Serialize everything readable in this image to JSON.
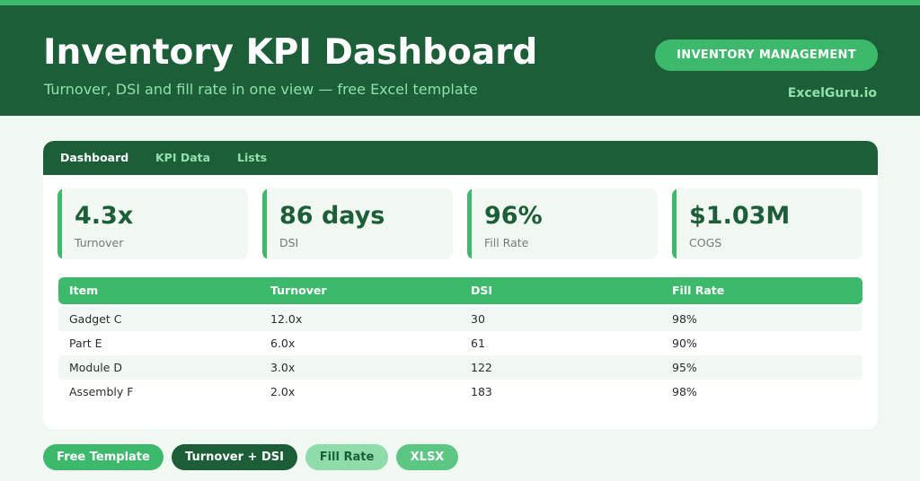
{
  "header": {
    "title": "Inventory KPI Dashboard",
    "subtitle": "Turnover, DSI and fill rate in one view — free Excel template",
    "badge": "INVENTORY MANAGEMENT",
    "brand": "ExcelGuru.io"
  },
  "tabs": [
    {
      "label": "Dashboard",
      "active": true
    },
    {
      "label": "KPI Data",
      "active": false
    },
    {
      "label": "Lists",
      "active": false
    }
  ],
  "kpis": [
    {
      "value": "4.3x",
      "label": "Turnover"
    },
    {
      "value": "86 days",
      "label": "DSI"
    },
    {
      "value": "96%",
      "label": "Fill Rate"
    },
    {
      "value": "$1.03M",
      "label": "COGS"
    }
  ],
  "table": {
    "columns": [
      "Item",
      "Turnover",
      "DSI",
      "Fill Rate"
    ],
    "rows": [
      [
        "Gadget C",
        "12.0x",
        "30",
        "98%"
      ],
      [
        "Part E",
        "6.0x",
        "61",
        "90%"
      ],
      [
        "Module D",
        "3.0x",
        "122",
        "95%"
      ],
      [
        "Assembly F",
        "2.0x",
        "183",
        "98%"
      ]
    ]
  },
  "tags": [
    "Free Template",
    "Turnover + DSI",
    "Fill Rate",
    "XLSX"
  ],
  "colors": {
    "dark_green": "#1b5e37",
    "accent_green": "#3cb96a",
    "light_green_text": "#8fe0ac",
    "background": "#f1f8f2"
  }
}
